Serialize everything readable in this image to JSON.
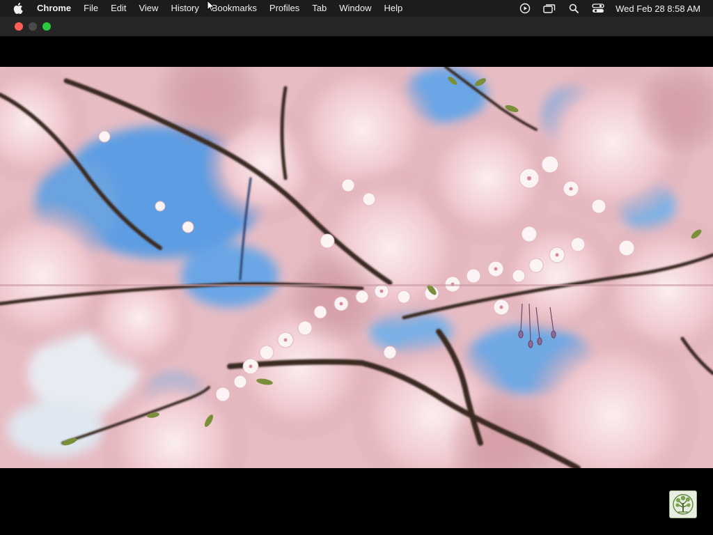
{
  "menubar": {
    "apple_icon": "apple-logo-icon",
    "app_name": "Chrome",
    "items": [
      "File",
      "Edit",
      "View",
      "History",
      "Bookmarks",
      "Profiles",
      "Tab",
      "Window",
      "Help"
    ],
    "status_icons": [
      "media-play-icon",
      "screen-mirroring-icon",
      "search-icon",
      "control-center-icon"
    ],
    "clock": "Wed Feb 28  8:58 AM"
  },
  "window": {
    "traffic_lights": {
      "close": "#ff5f57",
      "minimize": "#4a4a4a",
      "maximize": "#28c840"
    }
  },
  "video": {
    "subject": "cherry-blossom-video-frame",
    "colors": {
      "blossom": "#f0c9cf",
      "sky": "#5a9be0",
      "branch": "#3b2a24"
    }
  },
  "watermark": {
    "icon": "tree-logo-icon"
  }
}
